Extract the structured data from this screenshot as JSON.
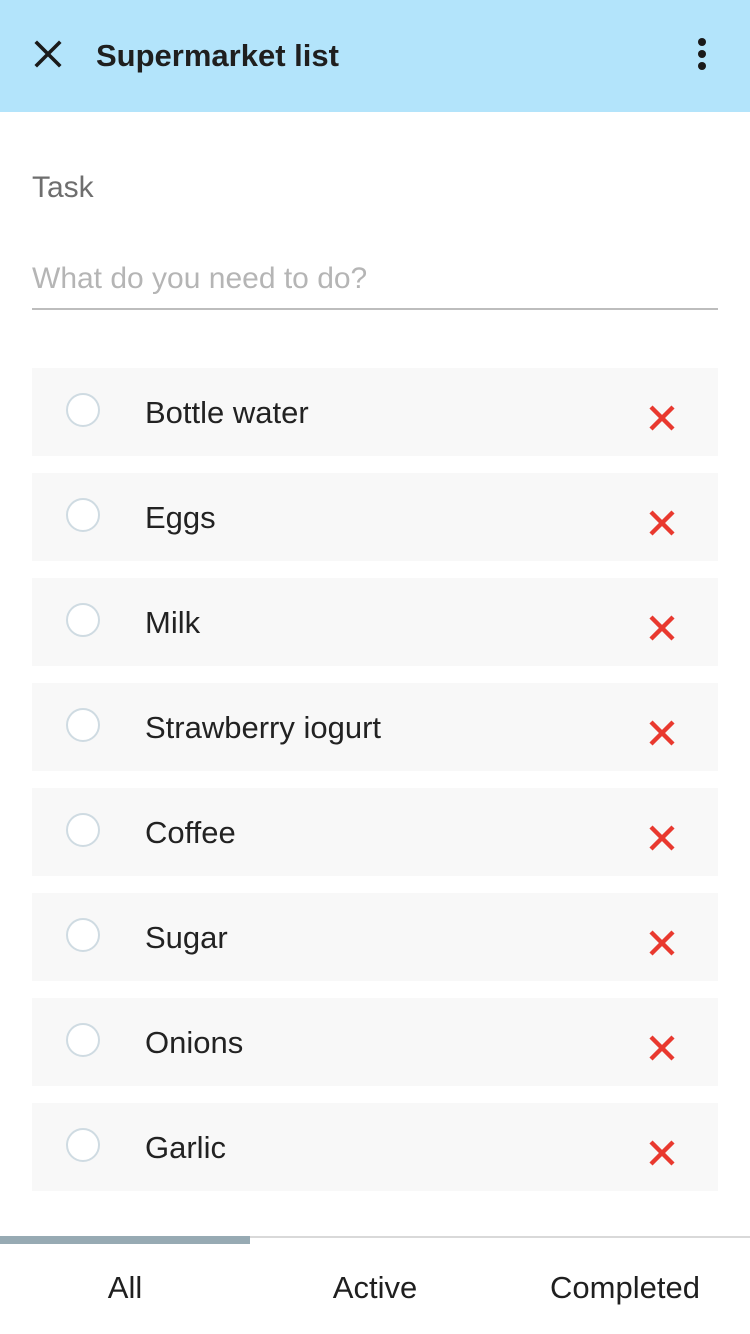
{
  "header": {
    "title": "Supermarket list",
    "close_icon": "close-icon",
    "menu_icon": "more-vertical-icon",
    "background_color": "#b3e4fb"
  },
  "form": {
    "label": "Task",
    "placeholder": "What do you need to do?",
    "value": ""
  },
  "todos": [
    {
      "label": "Bottle water",
      "completed": false
    },
    {
      "label": "Eggs",
      "completed": false
    },
    {
      "label": "Milk",
      "completed": false
    },
    {
      "label": "Strawberry iogurt",
      "completed": false
    },
    {
      "label": "Coffee",
      "completed": false
    },
    {
      "label": "Sugar",
      "completed": false
    },
    {
      "label": "Onions",
      "completed": false
    },
    {
      "label": "Garlic",
      "completed": false
    }
  ],
  "tabs": [
    {
      "label": "All",
      "selected": true
    },
    {
      "label": "Active",
      "selected": false
    },
    {
      "label": "Completed",
      "selected": false
    }
  ],
  "colors": {
    "delete": "#e9392f",
    "tab_indicator": "#97aab3"
  }
}
